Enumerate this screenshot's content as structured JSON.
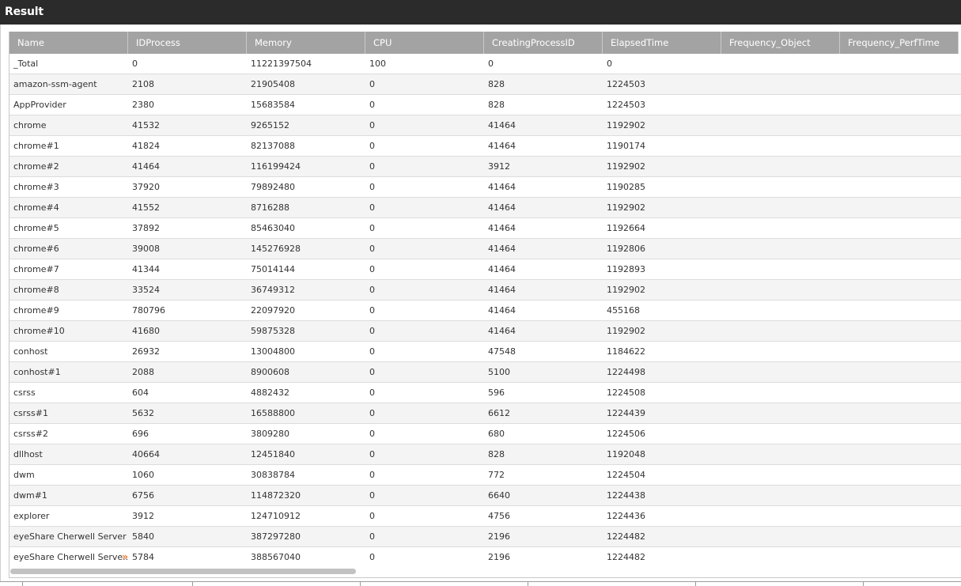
{
  "window": {
    "title": "Result"
  },
  "table": {
    "columns": [
      "Name",
      "IDProcess",
      "Memory",
      "CPU",
      "CreatingProcessID",
      "ElapsedTime",
      "Frequency_Object",
      "Frequency_PerfTime"
    ],
    "rows": [
      [
        "_Total",
        "0",
        "11221397504",
        "100",
        "0",
        "0",
        "",
        ""
      ],
      [
        "amazon-ssm-agent",
        "2108",
        "21905408",
        "0",
        "828",
        "1224503",
        "",
        ""
      ],
      [
        "AppProvider",
        "2380",
        "15683584",
        "0",
        "828",
        "1224503",
        "",
        ""
      ],
      [
        "chrome",
        "41532",
        "9265152",
        "0",
        "41464",
        "1192902",
        "",
        ""
      ],
      [
        "chrome#1",
        "41824",
        "82137088",
        "0",
        "41464",
        "1190174",
        "",
        ""
      ],
      [
        "chrome#2",
        "41464",
        "116199424",
        "0",
        "3912",
        "1192902",
        "",
        ""
      ],
      [
        "chrome#3",
        "37920",
        "79892480",
        "0",
        "41464",
        "1190285",
        "",
        ""
      ],
      [
        "chrome#4",
        "41552",
        "8716288",
        "0",
        "41464",
        "1192902",
        "",
        ""
      ],
      [
        "chrome#5",
        "37892",
        "85463040",
        "0",
        "41464",
        "1192664",
        "",
        ""
      ],
      [
        "chrome#6",
        "39008",
        "145276928",
        "0",
        "41464",
        "1192806",
        "",
        ""
      ],
      [
        "chrome#7",
        "41344",
        "75014144",
        "0",
        "41464",
        "1192893",
        "",
        ""
      ],
      [
        "chrome#8",
        "33524",
        "36749312",
        "0",
        "41464",
        "1192902",
        "",
        ""
      ],
      [
        "chrome#9",
        "780796",
        "22097920",
        "0",
        "41464",
        "455168",
        "",
        ""
      ],
      [
        "chrome#10",
        "41680",
        "59875328",
        "0",
        "41464",
        "1192902",
        "",
        ""
      ],
      [
        "conhost",
        "26932",
        "13004800",
        "0",
        "47548",
        "1184622",
        "",
        ""
      ],
      [
        "conhost#1",
        "2088",
        "8900608",
        "0",
        "5100",
        "1224498",
        "",
        ""
      ],
      [
        "csrss",
        "604",
        "4882432",
        "0",
        "596",
        "1224508",
        "",
        ""
      ],
      [
        "csrss#1",
        "5632",
        "16588800",
        "0",
        "6612",
        "1224439",
        "",
        ""
      ],
      [
        "csrss#2",
        "696",
        "3809280",
        "0",
        "680",
        "1224506",
        "",
        ""
      ],
      [
        "dllhost",
        "40664",
        "12451840",
        "0",
        "828",
        "1192048",
        "",
        ""
      ],
      [
        "dwm",
        "1060",
        "30838784",
        "0",
        "772",
        "1224504",
        "",
        ""
      ],
      [
        "dwm#1",
        "6756",
        "114872320",
        "0",
        "6640",
        "1224438",
        "",
        ""
      ],
      [
        "explorer",
        "3912",
        "124710912",
        "0",
        "4756",
        "1224436",
        "",
        ""
      ],
      [
        "eyeShare Cherwell Server",
        "5840",
        "387297280",
        "0",
        "2196",
        "1224482",
        "",
        ""
      ],
      [
        "eyeShare Cherwell Serve...",
        "5784",
        "388567040",
        "0",
        "2196",
        "1224482",
        "",
        ""
      ]
    ],
    "truncation_icon": "double-chevron-right-icon",
    "truncation_glyph": "»"
  },
  "colors": {
    "titlebar_bg": "#2b2b2b",
    "header_bg": "#a3a3a3",
    "accent": "#e87722"
  }
}
